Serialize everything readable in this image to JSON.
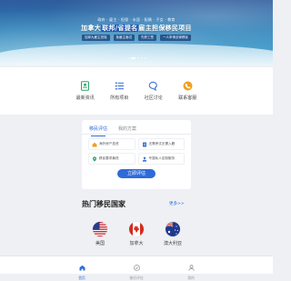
{
  "banner": {
    "subtitle": "政府 · 雇主 · 担保 · 永居 · 配偶 · 子女 · 教育",
    "title_prefix": "加拿大",
    "title_highlight": "联邦/省提名",
    "title_suffix": "雇主担保移民项目",
    "tags": [
      "加拿大雇主担保",
      "免雇主面试",
      "先获工签",
      "一人申请全家移民"
    ],
    "slides": 5,
    "active_slide": 1
  },
  "quick_links": [
    {
      "label": "最新资讯",
      "icon": "news-icon",
      "color": "#2ea36a"
    },
    {
      "label": "所有项目",
      "icon": "list-icon",
      "color": "#2f6bd8"
    },
    {
      "label": "社区讨论",
      "icon": "chat-icon",
      "color": "#2f6bd8"
    },
    {
      "label": "联系客服",
      "icon": "phone-icon",
      "color": "#f0a020"
    }
  ],
  "evaluation": {
    "tabs": [
      "移民评估",
      "我的方案"
    ],
    "active_tab": 0,
    "options": [
      {
        "label": "海外房产投资",
        "icon": "house-icon",
        "color": "#f0a020"
      },
      {
        "label": "无需考试无需入籍",
        "icon": "doc-icon",
        "color": "#2f6bd8"
      },
      {
        "label": "移民要求最低",
        "icon": "pin-icon",
        "color": "#2ea36a"
      },
      {
        "label": "专属私人定制服务",
        "icon": "person-icon",
        "color": "#2f6bd8"
      }
    ],
    "button_label": "立即评估"
  },
  "hot": {
    "title": "热门移民国家",
    "more_label": "更多>>",
    "countries": [
      {
        "name": "美国",
        "flag": "us-flag-icon"
      },
      {
        "name": "加拿大",
        "flag": "canada-flag-icon"
      },
      {
        "name": "澳大利亚",
        "flag": "australia-flag-icon"
      }
    ]
  },
  "bottom_nav": {
    "items": [
      {
        "label": "首页",
        "icon": "home-icon"
      },
      {
        "label": "移民评估",
        "icon": "assessment-icon"
      },
      {
        "label": "我的",
        "icon": "user-icon"
      }
    ],
    "active": 0
  },
  "colors": {
    "accent": "#2f6bd8",
    "green": "#2ea36a",
    "orange": "#f0a020",
    "background": "#eef0f4"
  }
}
